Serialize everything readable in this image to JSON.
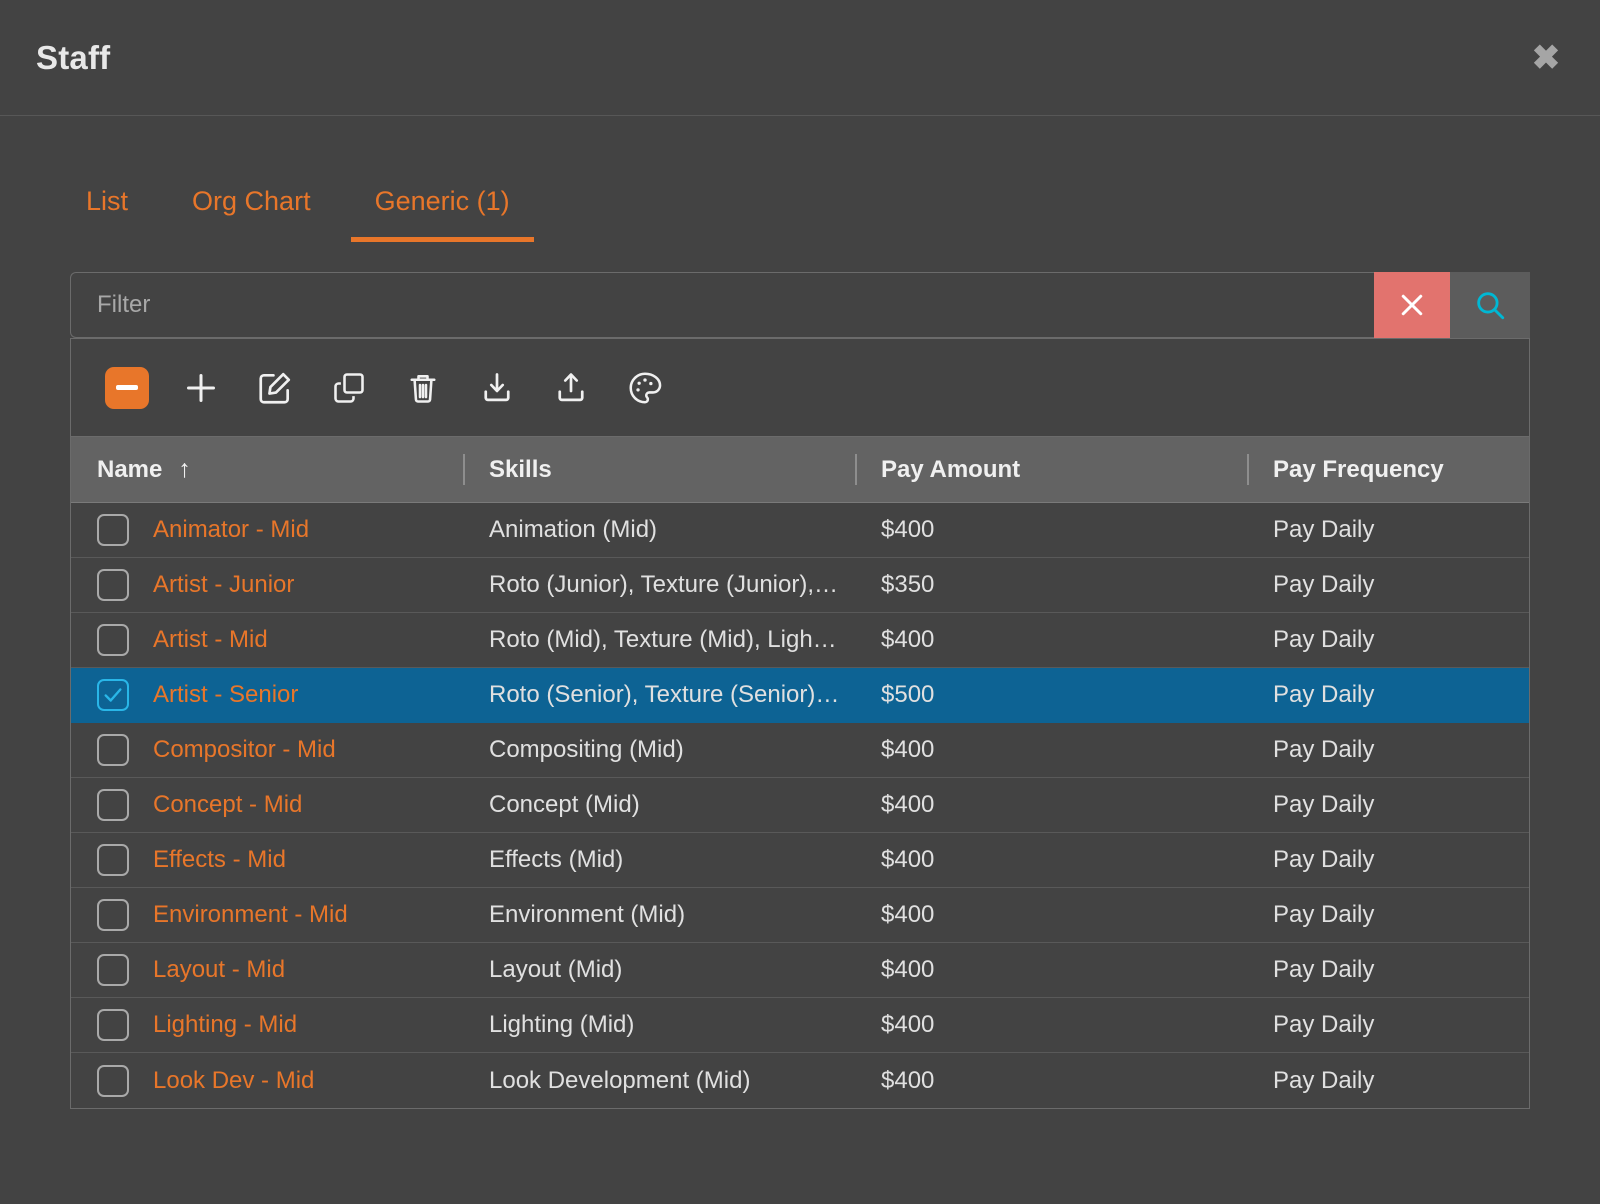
{
  "window": {
    "title": "Staff",
    "close_icon": "close-icon"
  },
  "tabs": [
    {
      "label": "List",
      "active": false
    },
    {
      "label": "Org Chart",
      "active": false
    },
    {
      "label": "Generic (1)",
      "active": true
    }
  ],
  "filter": {
    "placeholder": "Filter",
    "value": "",
    "clear_icon": "close-icon",
    "search_icon": "search-icon",
    "clear_color": "#e2736e",
    "search_color": "#00b8d4"
  },
  "toolbar": {
    "items": [
      {
        "name": "remove-button",
        "icon": "minus-icon",
        "accent": "#e8762a"
      },
      {
        "name": "add-button",
        "icon": "plus-icon"
      },
      {
        "name": "edit-button",
        "icon": "pencil-square-icon"
      },
      {
        "name": "duplicate-button",
        "icon": "copy-icon"
      },
      {
        "name": "delete-button",
        "icon": "trash-icon"
      },
      {
        "name": "import-button",
        "icon": "download-icon"
      },
      {
        "name": "export-button",
        "icon": "upload-icon"
      },
      {
        "name": "color-button",
        "icon": "palette-icon"
      }
    ]
  },
  "table": {
    "columns": [
      {
        "label": "Name",
        "sort": "asc",
        "sort_glyph": "↑"
      },
      {
        "label": "Skills",
        "sort": null
      },
      {
        "label": "Pay Amount",
        "sort": null
      },
      {
        "label": "Pay Frequency",
        "sort": null
      }
    ],
    "rows": [
      {
        "selected": false,
        "name": "Animator - Mid",
        "skills": "Animation (Mid)",
        "pay_amount": "$400",
        "pay_frequency": "Pay Daily"
      },
      {
        "selected": false,
        "name": "Artist - Junior",
        "skills": "Roto (Junior), Texture (Junior), …",
        "pay_amount": "$350",
        "pay_frequency": "Pay Daily"
      },
      {
        "selected": false,
        "name": "Artist - Mid",
        "skills": "Roto (Mid), Texture (Mid), Lighti…",
        "pay_amount": "$400",
        "pay_frequency": "Pay Daily"
      },
      {
        "selected": true,
        "name": "Artist - Senior",
        "skills": "Roto (Senior), Texture (Senior), …",
        "pay_amount": "$500",
        "pay_frequency": "Pay Daily"
      },
      {
        "selected": false,
        "name": "Compositor - Mid",
        "skills": "Compositing (Mid)",
        "pay_amount": "$400",
        "pay_frequency": "Pay Daily"
      },
      {
        "selected": false,
        "name": "Concept - Mid",
        "skills": "Concept (Mid)",
        "pay_amount": "$400",
        "pay_frequency": "Pay Daily"
      },
      {
        "selected": false,
        "name": "Effects - Mid",
        "skills": "Effects (Mid)",
        "pay_amount": "$400",
        "pay_frequency": "Pay Daily"
      },
      {
        "selected": false,
        "name": "Environment - Mid",
        "skills": "Environment (Mid)",
        "pay_amount": "$400",
        "pay_frequency": "Pay Daily"
      },
      {
        "selected": false,
        "name": "Layout - Mid",
        "skills": "Layout (Mid)",
        "pay_amount": "$400",
        "pay_frequency": "Pay Daily"
      },
      {
        "selected": false,
        "name": "Lighting - Mid",
        "skills": "Lighting (Mid)",
        "pay_amount": "$400",
        "pay_frequency": "Pay Daily"
      },
      {
        "selected": false,
        "name": "Look Dev - Mid",
        "skills": "Look Development (Mid)",
        "pay_amount": "$400",
        "pay_frequency": "Pay Daily"
      }
    ]
  },
  "colors": {
    "accent_orange": "#e8762a",
    "selection_blue": "#0d6394",
    "background": "#434343",
    "header_row": "#636363"
  }
}
